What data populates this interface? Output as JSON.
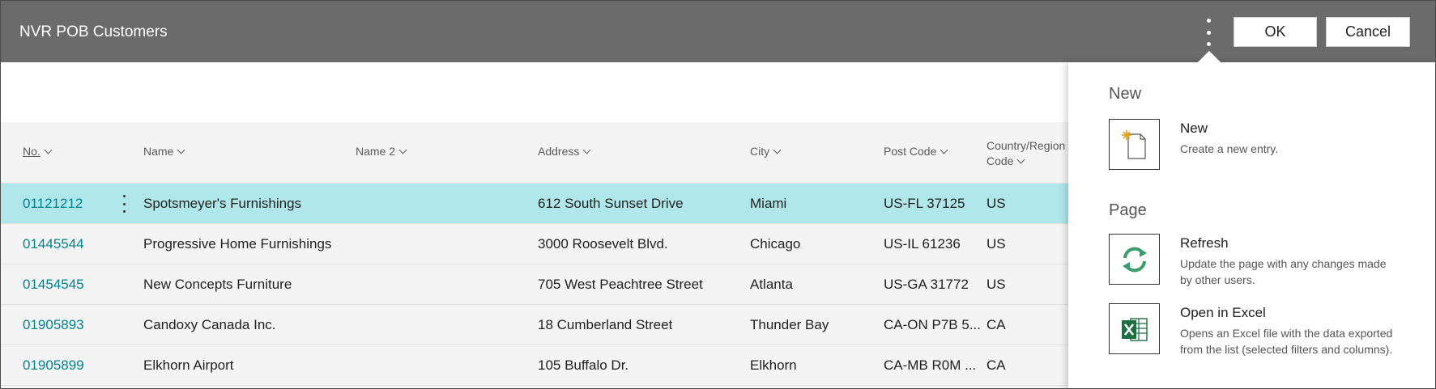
{
  "header": {
    "title": "NVR POB Customers",
    "ok_label": "OK",
    "cancel_label": "Cancel"
  },
  "columns": {
    "no": "No.",
    "name": "Name",
    "name2": "Name 2",
    "address": "Address",
    "city": "City",
    "post_code": "Post Code",
    "country_line1": "Country/Region",
    "country_line2": "Code"
  },
  "rows": [
    {
      "no": "01121212",
      "name": "Spotsmeyer's Furnishings",
      "name2": "",
      "address": "612 South Sunset Drive",
      "city": "Miami",
      "post_code": "US-FL 37125",
      "country": "US"
    },
    {
      "no": "01445544",
      "name": "Progressive Home Furnishings",
      "name2": "",
      "address": "3000 Roosevelt Blvd.",
      "city": "Chicago",
      "post_code": "US-IL 61236",
      "country": "US"
    },
    {
      "no": "01454545",
      "name": "New Concepts Furniture",
      "name2": "",
      "address": "705 West Peachtree Street",
      "city": "Atlanta",
      "post_code": "US-GA 31772",
      "country": "US"
    },
    {
      "no": "01905893",
      "name": "Candoxy Canada Inc.",
      "name2": "",
      "address": "18 Cumberland Street",
      "city": "Thunder Bay",
      "post_code": "CA-ON P7B 5...",
      "country": "CA"
    },
    {
      "no": "01905899",
      "name": "Elkhorn Airport",
      "name2": "",
      "address": "105 Buffalo Dr.",
      "city": "Elkhorn",
      "post_code": "CA-MB R0M ...",
      "country": "CA"
    }
  ],
  "panel": {
    "section_new": "New",
    "new_label": "New",
    "new_desc": "Create a new entry.",
    "section_page": "Page",
    "refresh_label": "Refresh",
    "refresh_desc": "Update the page with any changes made by other users.",
    "excel_label": "Open in Excel",
    "excel_desc": "Opens an Excel file with the data exported from the list (selected filters and columns)."
  },
  "colors": {
    "header_bg": "#6b6b6b",
    "selected_row": "#b0e7ea",
    "link": "#00838f",
    "excel_green": "#1d6f42",
    "refresh_green": "#2e8b57"
  },
  "icons": {
    "more_actions": "vertical-ellipsis-icon",
    "new": "new-document-icon",
    "refresh": "refresh-icon",
    "excel": "excel-icon"
  }
}
